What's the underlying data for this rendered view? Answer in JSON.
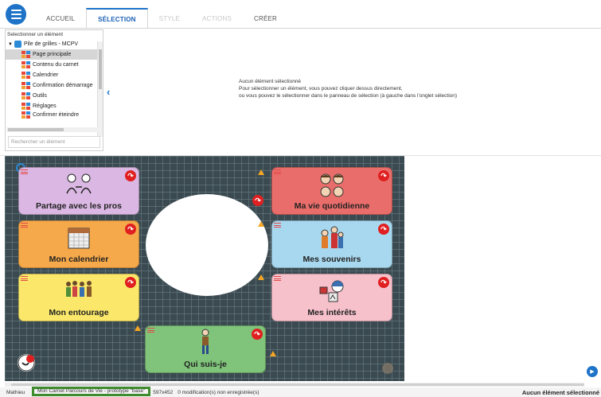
{
  "ribbon": {
    "tabs": [
      {
        "label": "ACCUEIL"
      },
      {
        "label": "SÉLECTION"
      },
      {
        "label": "STYLE"
      },
      {
        "label": "ACTIONS"
      },
      {
        "label": "CRÉER"
      }
    ]
  },
  "tree": {
    "header": "Selectionner un élément",
    "root": "Pile de grilles - MCPV",
    "items": [
      {
        "label": "Page principale"
      },
      {
        "label": "Contenu du carnet"
      },
      {
        "label": "Calendrier"
      },
      {
        "label": "Confirmation démarrage"
      },
      {
        "label": "Outils"
      },
      {
        "label": "Réglages"
      },
      {
        "label": "Confirmer éteindre"
      }
    ],
    "search_placeholder": "Rechercher un élément"
  },
  "info": {
    "line1": "Aucun élément sélectionné",
    "line2": "Pour sélectionner un élément, vous pouvez cliquer dessus directement,",
    "line3": "ou vous pouvez le sélectionner dans le panneau de sélection (à gauche dans l'onglet sélection)"
  },
  "cards": [
    {
      "label": "Partage avec les pros",
      "color": "#dbb8e3"
    },
    {
      "label": "Mon calendrier",
      "color": "#f6a94a"
    },
    {
      "label": "Mon entourage",
      "color": "#fbe86a"
    },
    {
      "label": "Ma vie quotidienne",
      "color": "#e96e6b"
    },
    {
      "label": "Mes souvenirs",
      "color": "#a8d8ef"
    },
    {
      "label": "Mes intérêts",
      "color": "#f7c1cc"
    },
    {
      "label": "Qui suis-je",
      "color": "#7fc47a"
    }
  ],
  "status": {
    "user": "Mathieu",
    "project": "Mon Carnet Parcours de Vie - prototype \"base\"",
    "dims": "597x452",
    "modifications": "0 modification(s) non enregistrée(s)",
    "selection": "Aucun élément sélectionné"
  },
  "colors": {
    "accent": "#1e73c8",
    "canvas": "#3b4a50",
    "highlight": "#3f8c2e"
  }
}
